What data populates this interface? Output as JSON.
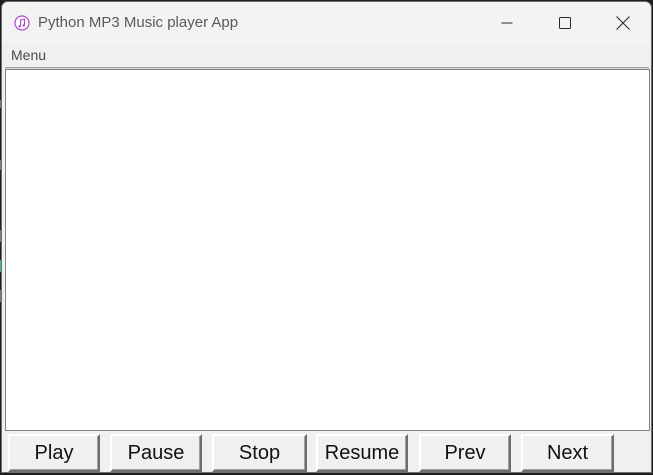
{
  "window": {
    "title": "Python MP3 Music player App"
  },
  "menubar": {
    "menu_label": "Menu"
  },
  "playlist": {
    "items": []
  },
  "controls": {
    "play": "Play",
    "pause": "Pause",
    "stop": "Stop",
    "resume": "Resume",
    "prev": "Prev",
    "next": "Next"
  },
  "icons": {
    "app": "music-note-icon",
    "minimize": "minimize-icon",
    "maximize": "maximize-icon",
    "close": "close-icon"
  },
  "colors": {
    "app_icon_accent": "#b04ad0",
    "window_bg": "#f0f0f0",
    "listbox_bg": "#ffffff"
  }
}
